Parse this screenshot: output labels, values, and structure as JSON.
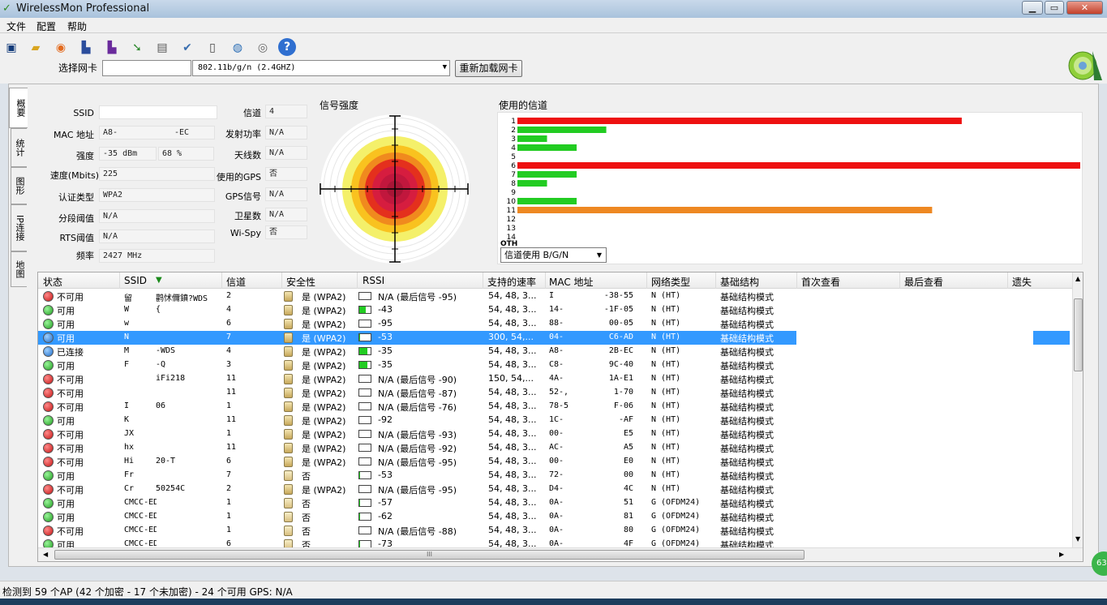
{
  "window": {
    "title": "WirelessMon Professional",
    "min": "▁",
    "max": "▭",
    "close": "✕"
  },
  "menu": [
    "文件",
    "配置",
    "帮助"
  ],
  "toolbar": {
    "icons": [
      "save-icon",
      "folder-icon",
      "record-icon",
      "network-card-icon",
      "network-card-alt-icon",
      "export-icon",
      "print-icon",
      "check-icon",
      "clipboard-icon",
      "globe-icon",
      "globe-network-icon",
      "help-icon"
    ]
  },
  "nic": {
    "label": "选择网卡",
    "value": "802.11b/g/n (2.4GHZ)",
    "reload": "重新加载网卡"
  },
  "tabs": [
    "概要",
    "统计",
    "图形",
    "IP连接",
    "地图"
  ],
  "info": {
    "ssid": {
      "label": "SSID",
      "value": ""
    },
    "mac": {
      "label": "MAC 地址",
      "value": "A8-",
      "value2": "-EC"
    },
    "strength": {
      "label": "强度",
      "dbm": "-35 dBm",
      "pct": "68 %"
    },
    "speed": {
      "label": "速度(Mbits)",
      "value": "225"
    },
    "auth": {
      "label": "认证类型",
      "value": "WPA2"
    },
    "frag": {
      "label": "分段阈值",
      "value": "N/A"
    },
    "rts": {
      "label": "RTS阈值",
      "value": "N/A"
    },
    "freq": {
      "label": "频率",
      "value": "2427 MHz"
    },
    "channel": {
      "label": "信道",
      "value": "4"
    },
    "txpower": {
      "label": "发射功率",
      "value": "N/A"
    },
    "antennas": {
      "label": "天线数",
      "value": "N/A"
    },
    "gps_used": {
      "label": "使用的GPS",
      "value": "否"
    },
    "gps_signal": {
      "label": "GPS信号",
      "value": "N/A"
    },
    "satellites": {
      "label": "卫星数",
      "value": "N/A"
    },
    "wispy": {
      "label": "Wi-Spy",
      "value": "否"
    }
  },
  "signal": {
    "title": "信号强度"
  },
  "channels": {
    "title": "使用的信道",
    "select": "信道使用 B/G/N",
    "oth_label": "OTH",
    "labels": [
      "1",
      "2",
      "3",
      "4",
      "5",
      "6",
      "7",
      "8",
      "9",
      "10",
      "11",
      "12",
      "13",
      "14"
    ],
    "usage": [
      {
        "ch": "1",
        "count": 15,
        "color": "#ee1111"
      },
      {
        "ch": "2",
        "count": 3,
        "color": "#22cc22"
      },
      {
        "ch": "3",
        "count": 1,
        "color": "#22cc22"
      },
      {
        "ch": "4",
        "count": 2,
        "color": "#22cc22"
      },
      {
        "ch": "5",
        "count": 0,
        "color": "#22cc22"
      },
      {
        "ch": "6",
        "count": 19,
        "color": "#ee1111"
      },
      {
        "ch": "7",
        "count": 2,
        "color": "#22cc22"
      },
      {
        "ch": "8",
        "count": 1,
        "color": "#22cc22"
      },
      {
        "ch": "9",
        "count": 0,
        "color": "#22cc22"
      },
      {
        "ch": "10",
        "count": 2,
        "color": "#22cc22"
      },
      {
        "ch": "11",
        "count": 14,
        "color": "#ee8822"
      },
      {
        "ch": "12",
        "count": 0,
        "color": "#22cc22"
      },
      {
        "ch": "13",
        "count": 0,
        "color": "#22cc22"
      },
      {
        "ch": "14",
        "count": 0,
        "color": "#22cc22"
      }
    ]
  },
  "table": {
    "headers": [
      "状态",
      "SSID",
      "信道",
      "安全性",
      "RSSI",
      "支持的速率",
      "MAC 地址",
      "网络类型",
      "基础结构",
      "首次查看",
      "最后查看",
      "遗失"
    ],
    "sort_marker": "▼",
    "rows": [
      {
        "color": "red",
        "status": "不可用",
        "ssid": "留",
        "ssid2": "鹳怵儞鐼?WDS",
        "ch": "2",
        "lock": true,
        "sec": "是 (WPA2)",
        "rssi_pct": 0,
        "rssi": "N/A (最后信号 -95)",
        "rates": "54, 48, 3...",
        "mac": "I",
        "mac2": "-38-55",
        "ntype": "N (HT)",
        "infra": "基础结构模式"
      },
      {
        "color": "green",
        "status": "可用",
        "ssid": "W",
        "ssid2": "{",
        "ch": "4",
        "lock": true,
        "sec": "是 (WPA2)",
        "rssi_pct": 60,
        "rssi": "-43",
        "rates": "54, 48, 3...",
        "mac": "14-",
        "mac2": "-1F-05",
        "ntype": "N (HT)",
        "infra": "基础结构模式"
      },
      {
        "color": "green",
        "status": "可用",
        "ssid": "w",
        "ssid2": "",
        "ch": "6",
        "lock": true,
        "sec": "是 (WPA2)",
        "rssi_pct": 0,
        "rssi": "-95",
        "rates": "54, 48, 3...",
        "mac": "88-",
        "mac2": "00-05",
        "ntype": "N (HT)",
        "infra": "基础结构模式"
      },
      {
        "color": "blue",
        "status": "可用",
        "ssid": "N",
        "ssid2": "",
        "ch": "7",
        "lock": true,
        "sec": "是 (WPA2)",
        "rssi_pct": 10,
        "rssi": "-53",
        "rates": "300, 54,...",
        "mac": "04-",
        "mac2": "C6-AD",
        "ntype": "N (HT)",
        "infra": "基础结构模式",
        "selected": true
      },
      {
        "color": "blue",
        "status": "已连接",
        "ssid": "M",
        "ssid2": "-WDS",
        "ch": "4",
        "lock": true,
        "sec": "是 (WPA2)",
        "rssi_pct": 70,
        "rssi": "-35",
        "rates": "54, 48, 3...",
        "mac": "A8-",
        "mac2": "2B-EC",
        "ntype": "N (HT)",
        "infra": "基础结构模式"
      },
      {
        "color": "green",
        "status": "可用",
        "ssid": "F",
        "ssid2": "-Q",
        "ch": "3",
        "lock": true,
        "sec": "是 (WPA2)",
        "rssi_pct": 70,
        "rssi": "-35",
        "rates": "54, 48, 3...",
        "mac": "C8-",
        "mac2": "9C-40",
        "ntype": "N (HT)",
        "infra": "基础结构模式"
      },
      {
        "color": "red",
        "status": "不可用",
        "ssid": "",
        "ssid2": "iFi218",
        "ch": "11",
        "lock": true,
        "sec": "是 (WPA2)",
        "rssi_pct": 0,
        "rssi": "N/A (最后信号 -90)",
        "rates": "150, 54,...",
        "mac": "4A-",
        "mac2": "1A-E1",
        "ntype": "N (HT)",
        "infra": "基础结构模式"
      },
      {
        "color": "red",
        "status": "不可用",
        "ssid": "",
        "ssid2": "",
        "ch": "11",
        "lock": true,
        "sec": "是 (WPA2)",
        "rssi_pct": 0,
        "rssi": "N/A (最后信号 -87)",
        "rates": "54, 48, 3...",
        "mac": "52-,",
        "mac2": "1-70",
        "ntype": "N (HT)",
        "infra": "基础结构模式"
      },
      {
        "color": "red",
        "status": "不可用",
        "ssid": "I",
        "ssid2": "06",
        "ch": "1",
        "lock": true,
        "sec": "是 (WPA2)",
        "rssi_pct": 0,
        "rssi": "N/A (最后信号 -76)",
        "rates": "54, 48, 3...",
        "mac": "78-5",
        "mac2": "F-06",
        "ntype": "N (HT)",
        "infra": "基础结构模式"
      },
      {
        "color": "green",
        "status": "可用",
        "ssid": "K",
        "ssid2": "",
        "ch": "11",
        "lock": true,
        "sec": "是 (WPA2)",
        "rssi_pct": 0,
        "rssi": "-92",
        "rates": "54, 48, 3...",
        "mac": "1C-",
        "mac2": "-AF",
        "ntype": "N (HT)",
        "infra": "基础结构模式"
      },
      {
        "color": "red",
        "status": "不可用",
        "ssid": "JX",
        "ssid2": "",
        "ch": "1",
        "lock": true,
        "sec": "是 (WPA2)",
        "rssi_pct": 0,
        "rssi": "N/A (最后信号 -93)",
        "rates": "54, 48, 3...",
        "mac": "00-",
        "mac2": "E5",
        "ntype": "N (HT)",
        "infra": "基础结构模式"
      },
      {
        "color": "red",
        "status": "不可用",
        "ssid": "hx",
        "ssid2": "",
        "ch": "11",
        "lock": true,
        "sec": "是 (WPA2)",
        "rssi_pct": 0,
        "rssi": "N/A (最后信号 -92)",
        "rates": "54, 48, 3...",
        "mac": "AC-",
        "mac2": "A5",
        "ntype": "N (HT)",
        "infra": "基础结构模式"
      },
      {
        "color": "red",
        "status": "不可用",
        "ssid": "Hi",
        "ssid2": "20-T",
        "ch": "6",
        "lock": true,
        "sec": "是 (WPA2)",
        "rssi_pct": 0,
        "rssi": "N/A (最后信号 -95)",
        "rates": "54, 48, 3...",
        "mac": "00-",
        "mac2": "E0",
        "ntype": "N (HT)",
        "infra": "基础结构模式"
      },
      {
        "color": "green",
        "status": "可用",
        "ssid": "Fr",
        "ssid2": "",
        "ch": "7",
        "lock": false,
        "sec": "否",
        "rssi_pct": 10,
        "rssi": "-53",
        "rates": "54, 48, 3...",
        "mac": "72-",
        "mac2": "00",
        "ntype": "N (HT)",
        "infra": "基础结构模式"
      },
      {
        "color": "red",
        "status": "不可用",
        "ssid": "Cr",
        "ssid2": "50254C",
        "ch": "2",
        "lock": true,
        "sec": "是 (WPA2)",
        "rssi_pct": 0,
        "rssi": "N/A (最后信号 -95)",
        "rates": "54, 48, 3...",
        "mac": "D4-",
        "mac2": "4C",
        "ntype": "N (HT)",
        "infra": "基础结构模式"
      },
      {
        "color": "green",
        "status": "可用",
        "ssid": "CMCC-EDU",
        "ssid2": "",
        "ch": "1",
        "lock": false,
        "sec": "否",
        "rssi_pct": 8,
        "rssi": "-57",
        "rates": "54, 48, 3...",
        "mac": "0A-",
        "mac2": "51",
        "ntype": "G (OFDM24)",
        "infra": "基础结构模式"
      },
      {
        "color": "green",
        "status": "可用",
        "ssid": "CMCC-EDU",
        "ssid2": "",
        "ch": "1",
        "lock": false,
        "sec": "否",
        "rssi_pct": 5,
        "rssi": "-62",
        "rates": "54, 48, 3...",
        "mac": "0A-",
        "mac2": "81",
        "ntype": "G (OFDM24)",
        "infra": "基础结构模式"
      },
      {
        "color": "red",
        "status": "不可用",
        "ssid": "CMCC-EDU",
        "ssid2": "",
        "ch": "1",
        "lock": false,
        "sec": "否",
        "rssi_pct": 0,
        "rssi": "N/A (最后信号 -88)",
        "rates": "54, 48, 3...",
        "mac": "0A-",
        "mac2": "80",
        "ntype": "G (OFDM24)",
        "infra": "基础结构模式"
      },
      {
        "color": "green",
        "status": "可用",
        "ssid": "CMCC-EDU",
        "ssid2": "",
        "ch": "6",
        "lock": false,
        "sec": "否",
        "rssi_pct": 2,
        "rssi": "-73",
        "rates": "54, 48, 3...",
        "mac": "0A-",
        "mac2": "4F",
        "ntype": "G (OFDM24)",
        "infra": "基础结构模式"
      }
    ],
    "hscroll_grip": "III"
  },
  "status": {
    "text": "检测到 59 个AP (42 个加密 - 17 个未加密) - 24 个可用   GPS: N/A",
    "badge": "63"
  }
}
